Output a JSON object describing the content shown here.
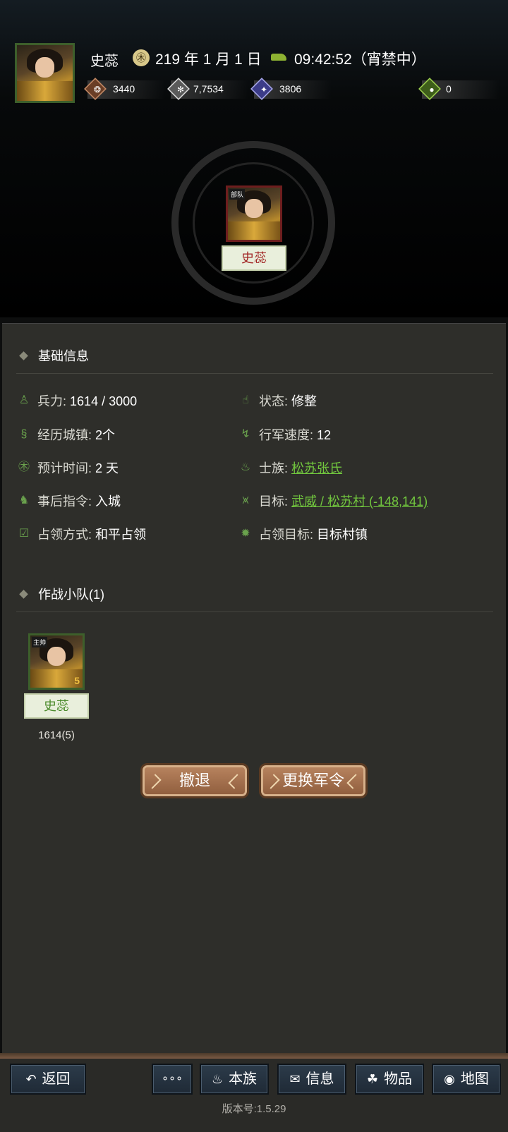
{
  "header": {
    "player_name": "史蕊",
    "date_icon": "calendar-seal-icon",
    "date": "219 年 1 月 1 日",
    "time_icon": "horse-icon",
    "time": "09:42:52（宵禁中）",
    "resources": [
      {
        "icon": "coin-icon",
        "value": "3440",
        "color": "#a0623a"
      },
      {
        "icon": "grain-icon",
        "value": "7,7534",
        "color": "#c9c9c9"
      },
      {
        "icon": "soldier-icon",
        "value": "3806",
        "color": "#5a5aa8"
      },
      {
        "icon": "bag-icon",
        "value": "0",
        "color": "#6b9e2e"
      }
    ]
  },
  "unit": {
    "tag": "部队",
    "name": "史蕊"
  },
  "basic_info": {
    "title": "基础信息",
    "troops_label": "兵力:",
    "troops_value": "1614 / 3000",
    "status_label": "状态:",
    "status_value": "修整",
    "cities_label": "经历城镇:",
    "cities_value": "2个",
    "speed_label": "行军速度:",
    "speed_value": "12",
    "eta_label": "预计时间:",
    "eta_value": "2 天",
    "clan_label": "士族:",
    "clan_value": "松苏张氏",
    "after_label": "事后指令:",
    "after_value": "入城",
    "target_label": "目标:",
    "target_value": "武威 / 松苏村 (-148,141)",
    "occupy_label": "占领方式:",
    "occupy_value": "和平占领",
    "occupy_target_label": "占领目标:",
    "occupy_target_value": "目标村镇"
  },
  "squad": {
    "title": "作战小队(1)",
    "members": [
      {
        "tag": "主帅",
        "stars": "5",
        "name": "史蕊",
        "count": "1614(5)"
      }
    ]
  },
  "actions": {
    "retreat": "撤退",
    "change_order": "更换军令"
  },
  "nav": {
    "back": "返回",
    "more": "∘∘∘",
    "clan": "本族",
    "info": "信息",
    "items": "物品",
    "map": "地图"
  },
  "version": "版本号:1.5.29"
}
